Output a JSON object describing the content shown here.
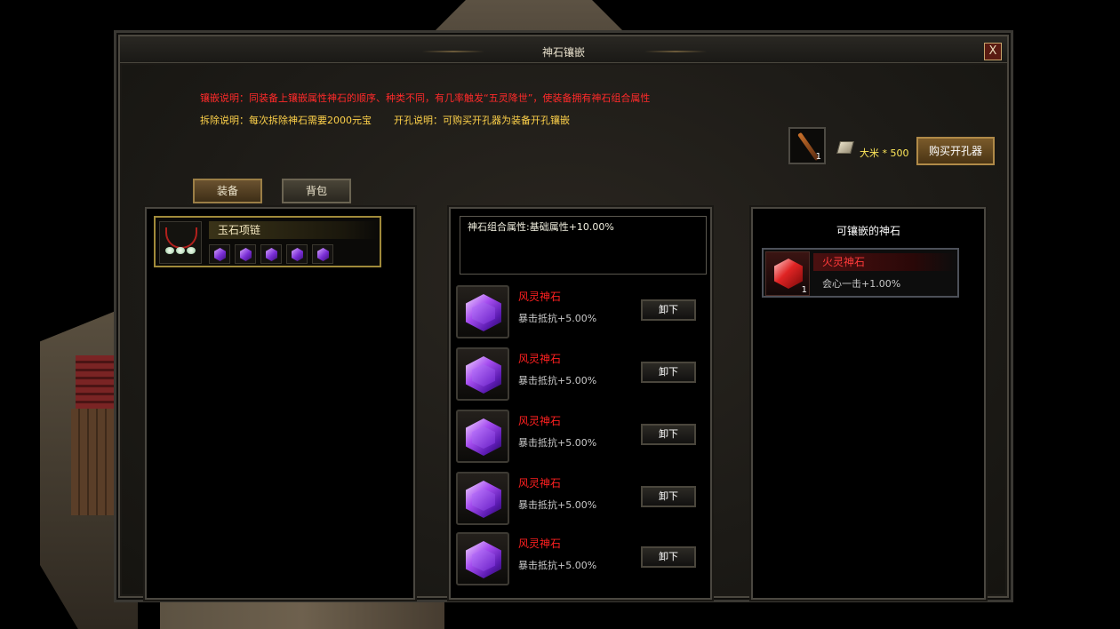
{
  "window": {
    "title": "神石镶嵌",
    "close_label": "X"
  },
  "descriptions": {
    "inlay": "镶嵌说明：同装备上镶嵌属性神石的顺序、种类不同，有几率触发“五灵降世”，使装备拥有神石组合属性",
    "remove": "拆除说明：每次拆除神石需要2000元宝",
    "open": "开孔说明：可购买开孔器为装备开孔镶嵌"
  },
  "shop": {
    "item_count": "1",
    "currency_label": "大米 * 500",
    "buy_button": "购买开孔器"
  },
  "tabs": [
    {
      "label": "装备",
      "active": true
    },
    {
      "label": "背包",
      "active": false
    }
  ],
  "equipment": {
    "name": "玉石项链",
    "gem_slots": 5
  },
  "combo": {
    "text": "神石组合属性:基础属性+10.00%"
  },
  "inlaid_gems": [
    {
      "name": "风灵神石",
      "stat": "暴击抵抗+5.00%",
      "button": "卸下"
    },
    {
      "name": "风灵神石",
      "stat": "暴击抵抗+5.00%",
      "button": "卸下"
    },
    {
      "name": "风灵神石",
      "stat": "暴击抵抗+5.00%",
      "button": "卸下"
    },
    {
      "name": "风灵神石",
      "stat": "暴击抵抗+5.00%",
      "button": "卸下"
    },
    {
      "name": "风灵神石",
      "stat": "暴击抵抗+5.00%",
      "button": "卸下"
    }
  ],
  "available": {
    "title": "可镶嵌的神石",
    "items": [
      {
        "name": "火灵神石",
        "stat": "会心一击+1.00%",
        "count": "1"
      }
    ]
  },
  "colors": {
    "red_text": "#ff2a2a",
    "yellow_text": "#ffd24a",
    "gold_border": "#a08a3a"
  }
}
